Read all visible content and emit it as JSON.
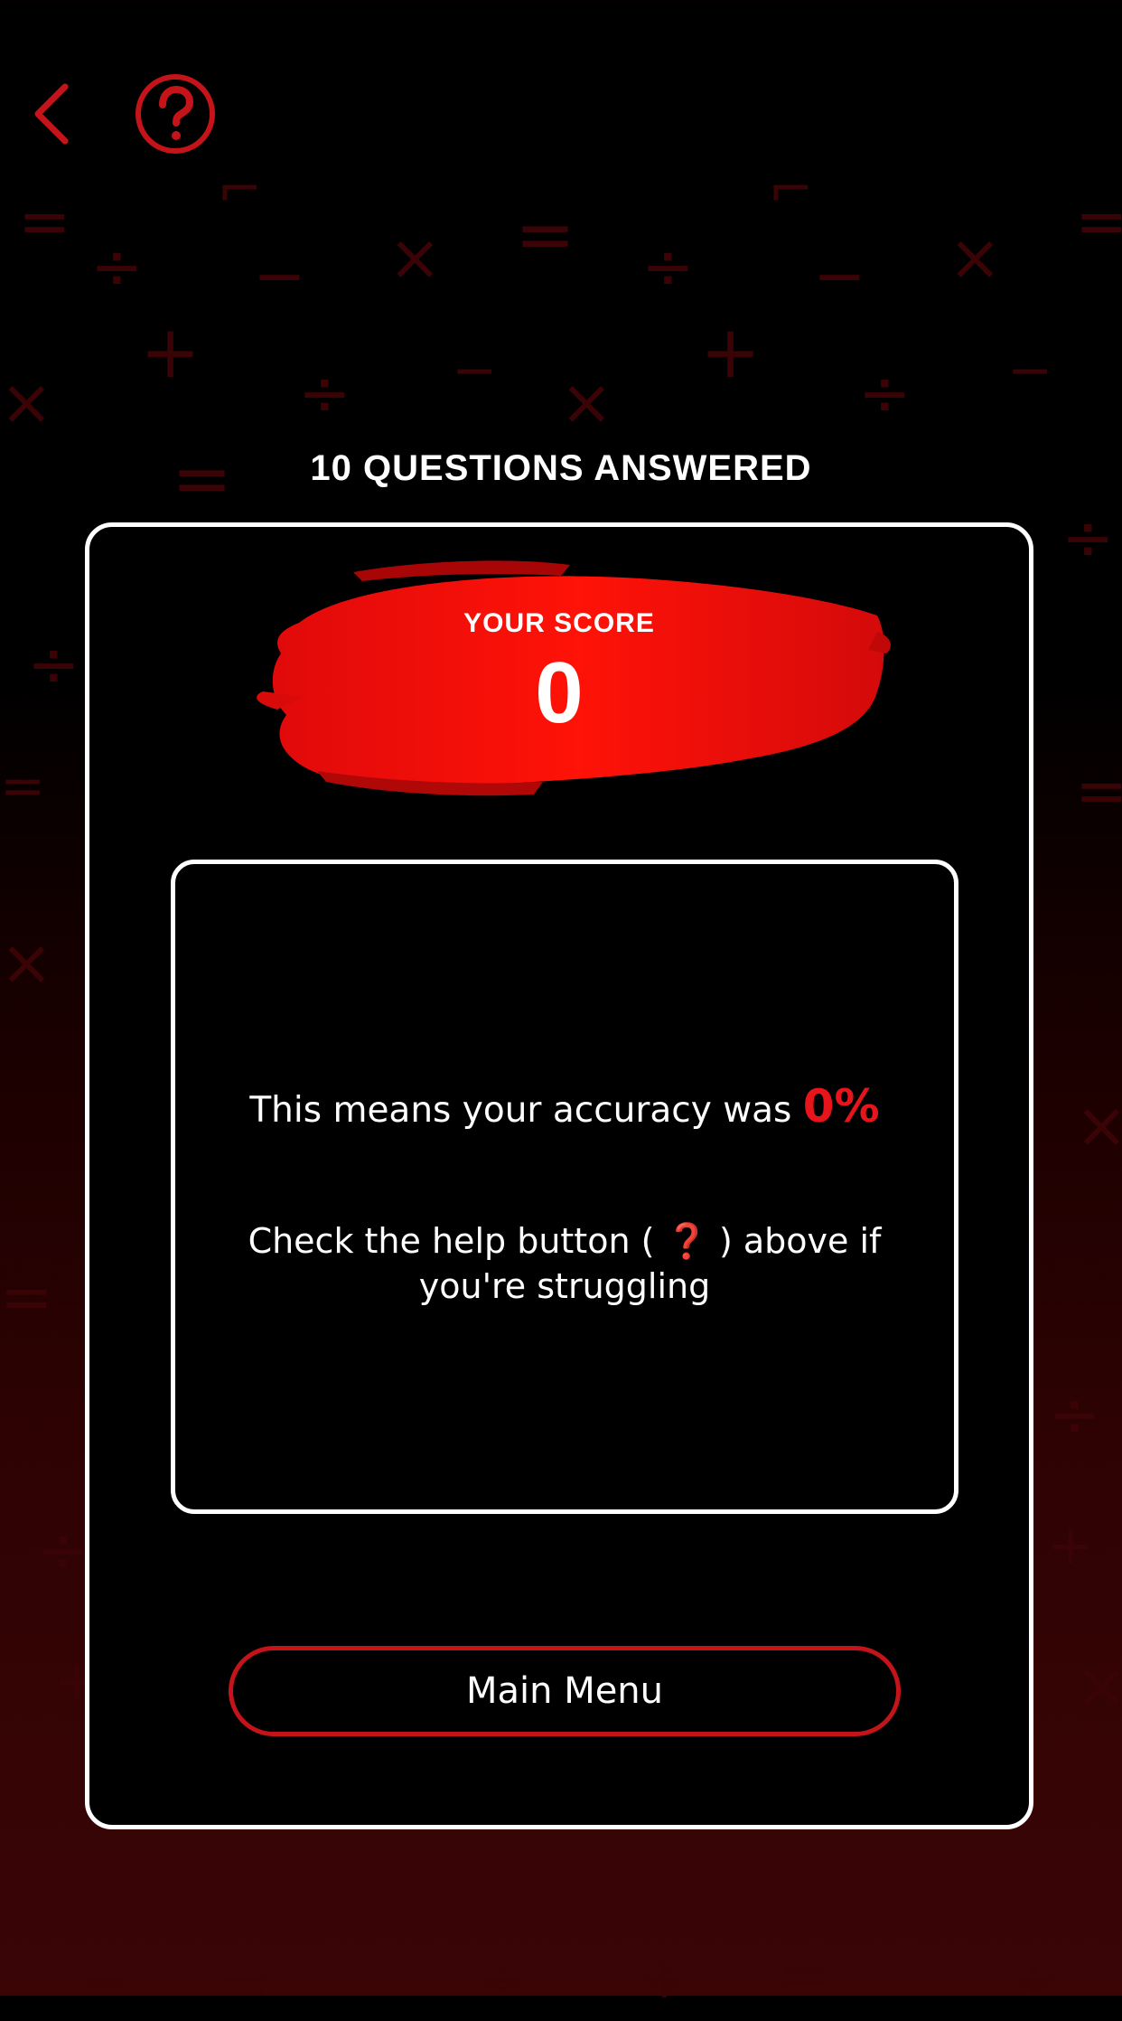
{
  "header": {
    "back_icon": "chevron-left-icon",
    "help_icon": "question-circle-icon"
  },
  "questions_answered_title": "10 QUESTIONS ANSWERED",
  "score": {
    "label": "YOUR SCORE",
    "value": "0"
  },
  "message": {
    "accuracy_text": "This means your accuracy was",
    "accuracy_value": "0%",
    "help_prefix": "Check the help button (",
    "help_symbol": "❓",
    "help_suffix": ") above if you're struggling"
  },
  "main_menu_button": "Main Menu",
  "colors": {
    "accent": "#c4141a",
    "background_top": "#000000",
    "background_bottom": "#3b0506"
  }
}
